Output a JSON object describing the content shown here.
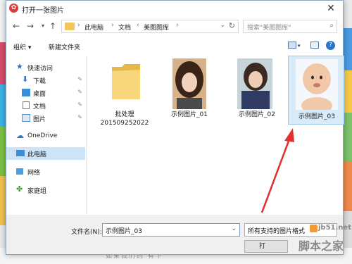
{
  "window": {
    "title": "打开一张图片"
  },
  "nav": {
    "breadcrumbs": [
      "此电脑",
      "文档",
      "美图图库"
    ],
    "search_placeholder": "搜索\"美图图库\""
  },
  "toolbar": {
    "organize": "组织 ▾",
    "new_folder": "新建文件夹"
  },
  "sidebar": {
    "items": [
      {
        "label": "快速访问",
        "icon": "star-icon"
      },
      {
        "label": "下载",
        "icon": "download-icon"
      },
      {
        "label": "桌面",
        "icon": "desktop-icon"
      },
      {
        "label": "文档",
        "icon": "document-icon"
      },
      {
        "label": "图片",
        "icon": "pictures-icon"
      },
      {
        "label": "OneDrive",
        "icon": "cloud-icon"
      },
      {
        "label": "此电脑",
        "icon": "pc-icon"
      },
      {
        "label": "网络",
        "icon": "network-icon"
      },
      {
        "label": "家庭组",
        "icon": "homegroup-icon"
      }
    ]
  },
  "files": [
    {
      "name_line1": "批处理",
      "name_line2": "201509252022"
    },
    {
      "name_line1": "示例图片_01"
    },
    {
      "name_line1": "示例图片_02"
    },
    {
      "name_line1": "示例图片_03"
    }
  ],
  "footer": {
    "filename_label": "文件名(N):",
    "filename_value": "示例图片_03",
    "type_value": "所有支持的图片格式",
    "open_label": "打"
  },
  "watermark": {
    "site": "jb51.net",
    "brand": "脚本之家"
  },
  "background": {
    "bottom_text": "如果我们的  有下"
  }
}
